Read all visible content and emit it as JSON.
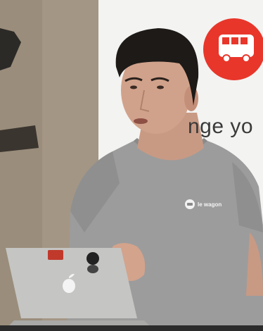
{
  "banner": {
    "visible_text": "nge yo",
    "logo_icon": "bus-icon",
    "logo_color": "#e8362b"
  },
  "shirt": {
    "logo_text": "le wagon",
    "logo_icon": "wagon-icon"
  },
  "laptop": {
    "logo_icon": "apple-logo-icon",
    "stickers": [
      "octocat-sticker",
      "red-badge-sticker"
    ]
  }
}
